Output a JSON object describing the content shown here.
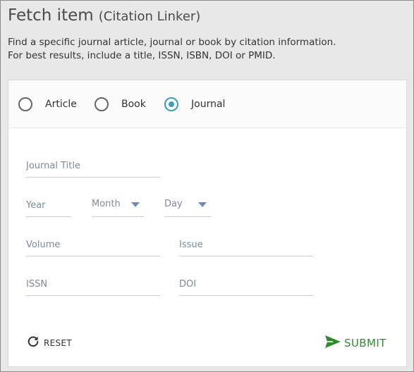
{
  "header": {
    "title": "Fetch item",
    "subtitle": "(Citation Linker)",
    "description_line1": "Find a specific journal article, journal or book by citation information.",
    "description_line2": "For best results, include a title, ISSN, ISBN, DOI or PMID."
  },
  "item_type": {
    "options": [
      {
        "label": "Article",
        "selected": false
      },
      {
        "label": "Book",
        "selected": false
      },
      {
        "label": "Journal",
        "selected": true
      }
    ]
  },
  "form": {
    "journal_title_placeholder": "Journal Title",
    "year_placeholder": "Year",
    "month_label": "Month",
    "day_label": "Day",
    "volume_placeholder": "Volume",
    "issue_placeholder": "Issue",
    "issn_placeholder": "ISSN",
    "doi_placeholder": "DOI"
  },
  "actions": {
    "reset_label": "RESET",
    "submit_label": "SUBMIT"
  },
  "colors": {
    "accent_radio": "#3a9fb5",
    "submit_green": "#2e8b2e",
    "placeholder": "#7c8a9c"
  }
}
